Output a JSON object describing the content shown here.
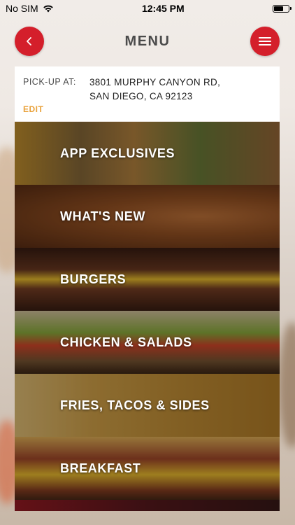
{
  "status_bar": {
    "carrier": "No SIM",
    "time": "12:45 PM"
  },
  "nav": {
    "title": "MENU"
  },
  "pickup": {
    "label": "PICK-UP AT:",
    "address_line1": "3801 MURPHY CANYON RD,",
    "address_line2": "SAN DIEGO, CA 92123",
    "edit_label": "EDIT"
  },
  "categories": [
    {
      "label": "APP EXCLUSIVES"
    },
    {
      "label": "WHAT'S NEW"
    },
    {
      "label": "BURGERS"
    },
    {
      "label": "CHICKEN & SALADS"
    },
    {
      "label": "FRIES, TACOS & SIDES"
    },
    {
      "label": "BREAKFAST"
    },
    {
      "label": ""
    }
  ],
  "colors": {
    "accent_red": "#d41f2b",
    "edit_orange": "#e9a23b"
  },
  "icons": {
    "back": "chevron-left-icon",
    "menu": "hamburger-icon",
    "wifi": "wifi-icon",
    "battery": "battery-icon"
  }
}
